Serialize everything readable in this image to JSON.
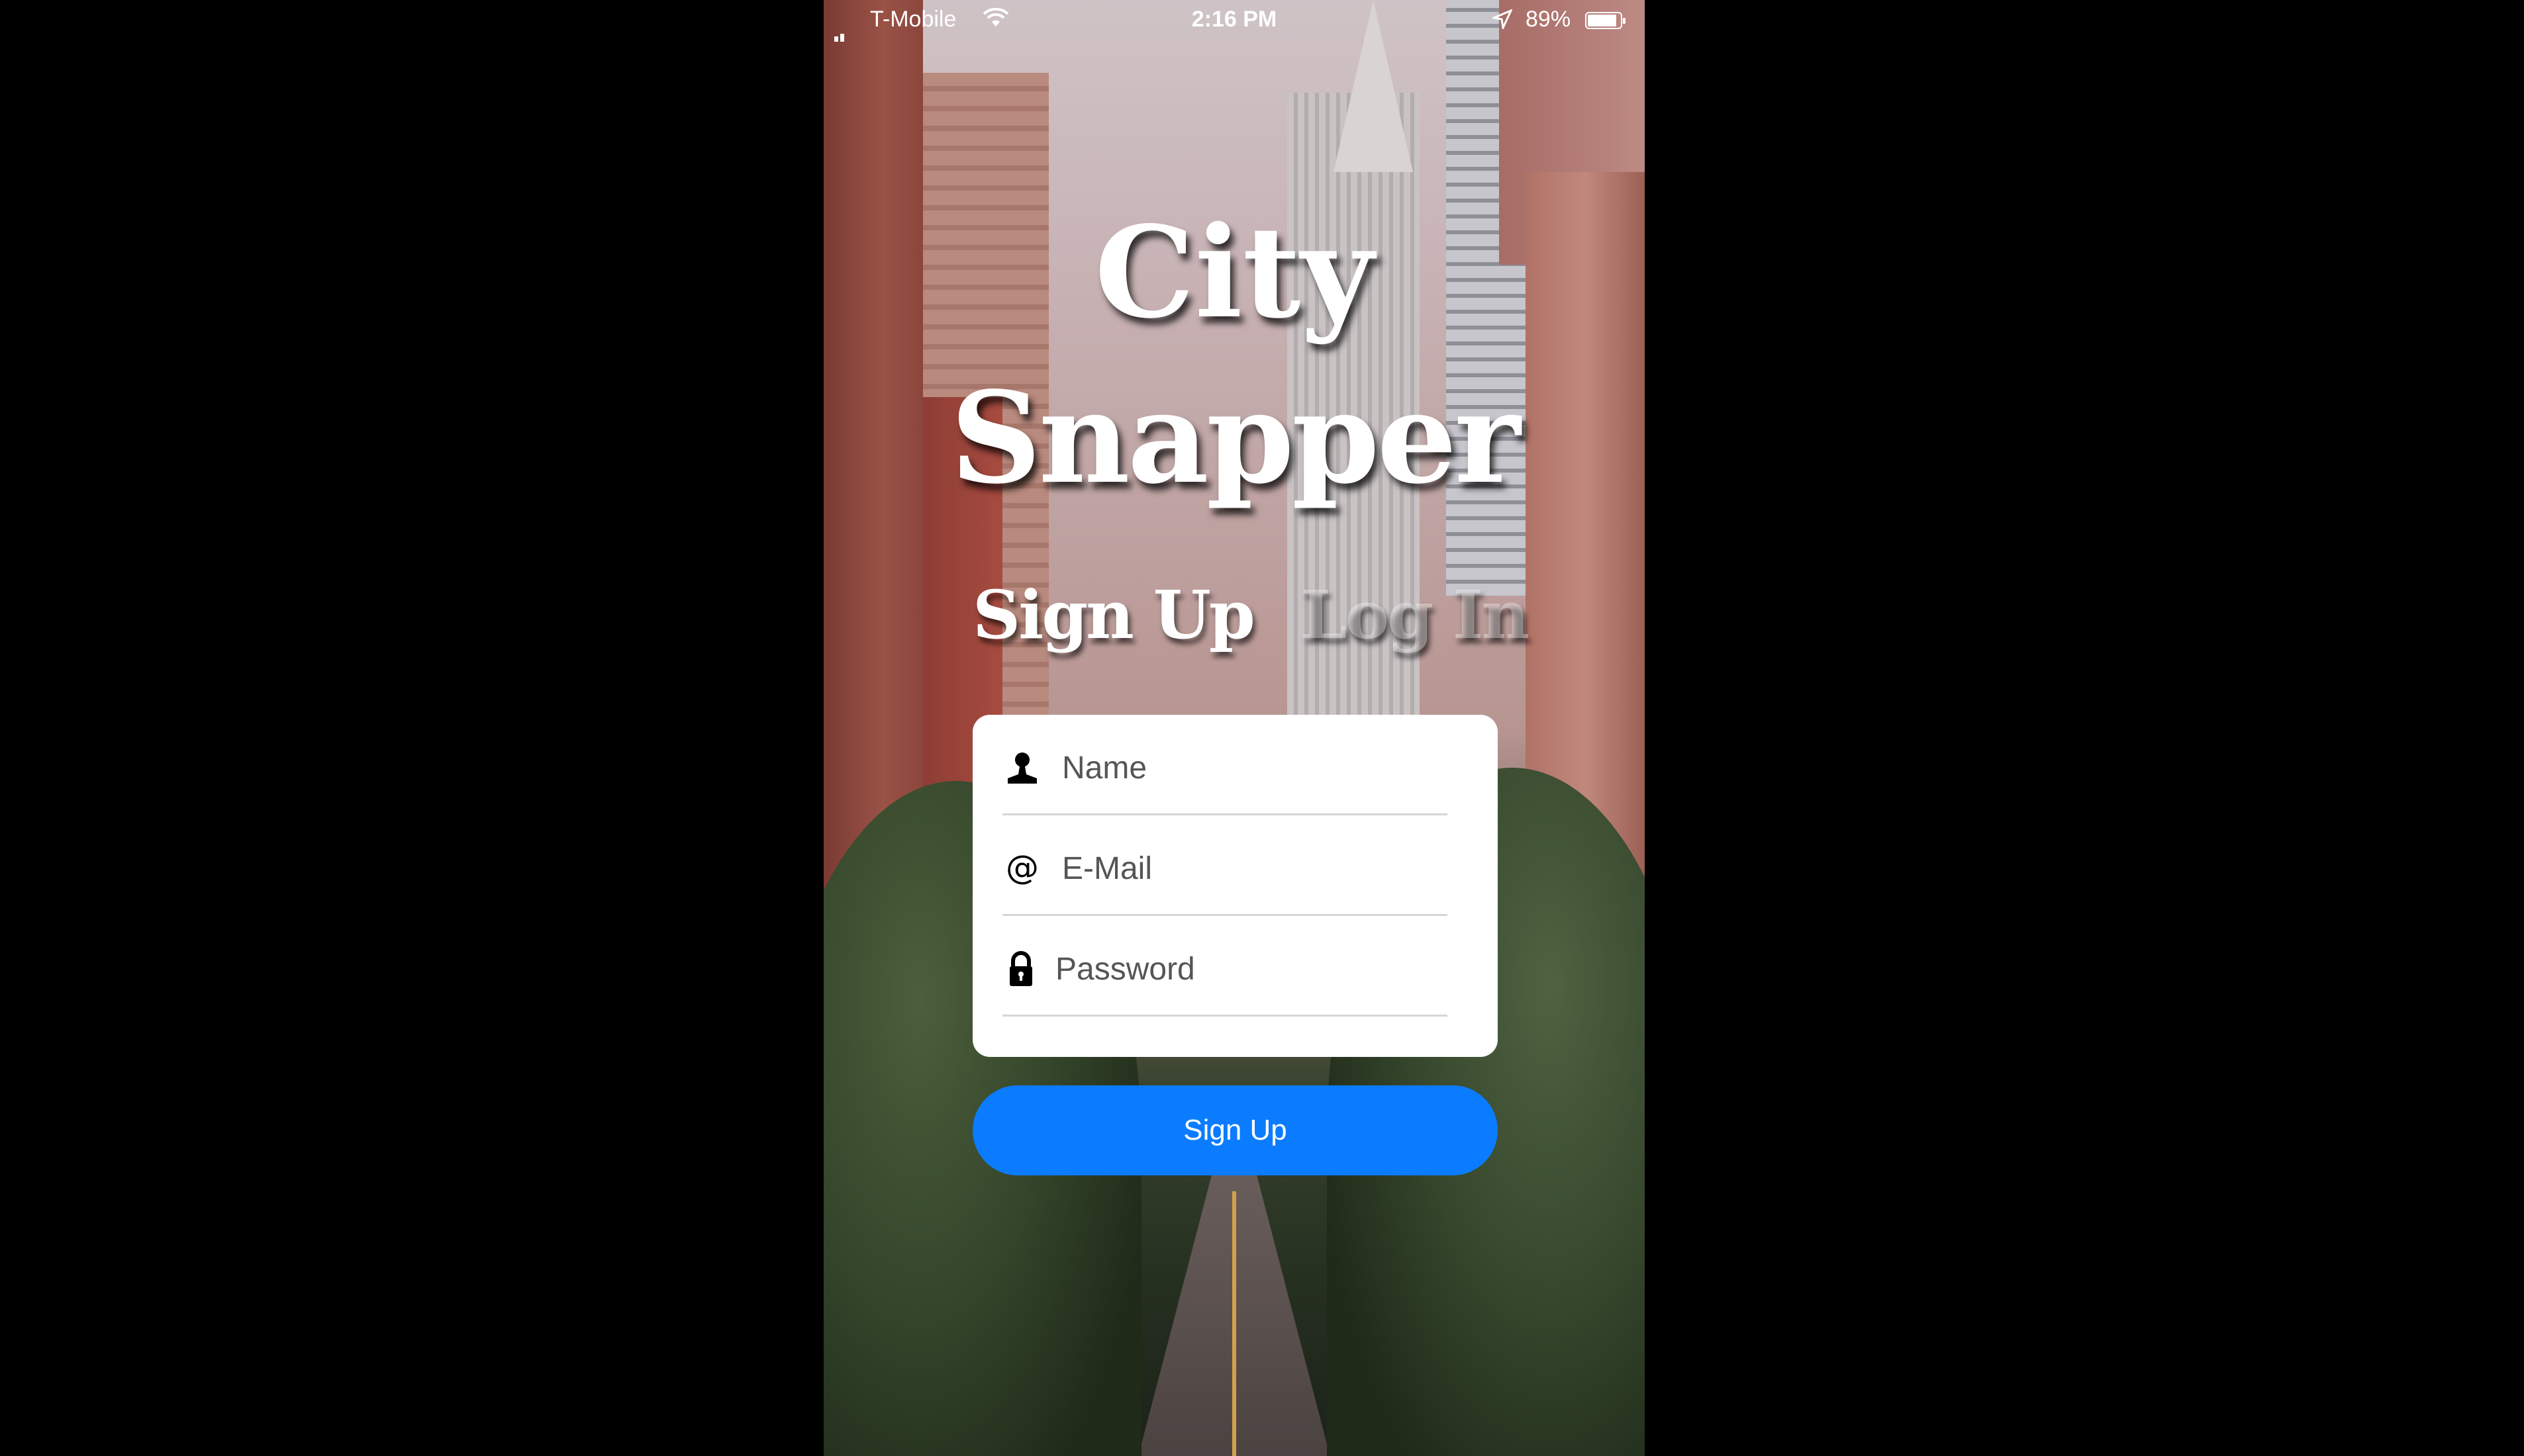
{
  "status_bar": {
    "carrier": "T-Mobile",
    "time": "2:16 PM",
    "battery": "89%",
    "battery_level": 0.89
  },
  "app": {
    "title_line1": "City",
    "title_line2": "Snapper"
  },
  "tabs": {
    "signup": "Sign Up",
    "login": "Log In"
  },
  "form": {
    "name_placeholder": "Name",
    "email_placeholder": "E-Mail",
    "password_placeholder": "Password",
    "name_icon": "person-icon",
    "email_icon": "at-icon",
    "password_icon": "lock-icon"
  },
  "submit_label": "Sign Up",
  "colors": {
    "accent": "#0b7cff",
    "background": "#000000"
  }
}
